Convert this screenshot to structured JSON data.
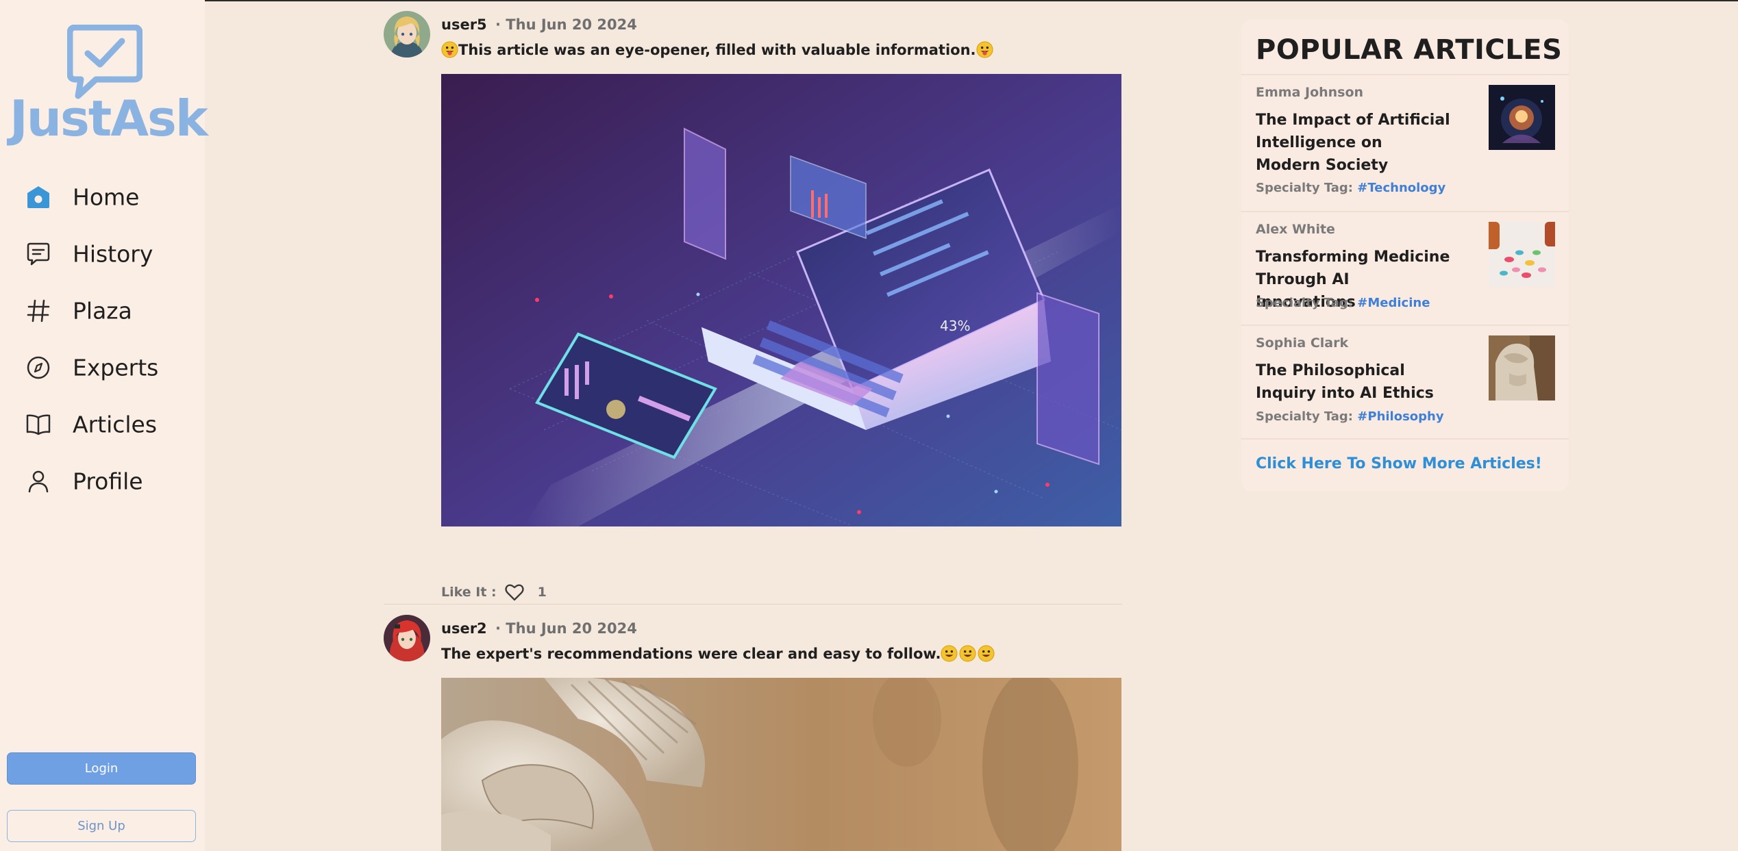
{
  "app": {
    "name": "JustAsk",
    "brand_color": "#8ab3e2",
    "accent_color": "#6fa0e3",
    "background": "#f5e8dc"
  },
  "sidebar": {
    "items": [
      {
        "label": "Home",
        "icon": "home-icon",
        "active": true
      },
      {
        "label": "History",
        "icon": "chat-bubble-icon"
      },
      {
        "label": "Plaza",
        "icon": "hashtag-icon"
      },
      {
        "label": "Experts",
        "icon": "compass-icon"
      },
      {
        "label": "Articles",
        "icon": "book-icon"
      },
      {
        "label": "Profile",
        "icon": "user-icon"
      }
    ],
    "login_label": "Login",
    "signup_label": "Sign Up"
  },
  "feed": {
    "posts": [
      {
        "user": "user5",
        "date": "· Thu Jun 20 2024",
        "text": "This article was an eye-opener, filled with valuable information.",
        "image": "isometric laptop and smartphone with data dashboards",
        "like_label": "Like It :",
        "likes": "1"
      },
      {
        "user": "user2",
        "date": "· Thu Jun 20 2024",
        "text": "The expert's recommendations were clear and easy to follow.",
        "image": "marble statue helmet close-up"
      }
    ]
  },
  "popular": {
    "title": "POPULAR ARTICLES",
    "articles": [
      {
        "author": "Emma Johnson",
        "title": "The Impact of Artificial Intelligence on Modern Society",
        "tag_label": "Specialty Tag:",
        "tag": "#Technology",
        "thumb": "glowing ai figure"
      },
      {
        "author": "Alex White",
        "title": "Transforming Medicine Through AI Innovations",
        "tag_label": "Specialty Tag:",
        "tag": "#Medicine",
        "thumb": "colorful pills"
      },
      {
        "author": "Sophia Clark",
        "title": "The Philosophical Inquiry into AI Ethics",
        "tag_label": "Specialty Tag:",
        "tag": "#Philosophy",
        "thumb": "classical statue"
      }
    ],
    "more_label": "Click Here To Show More Articles!"
  }
}
